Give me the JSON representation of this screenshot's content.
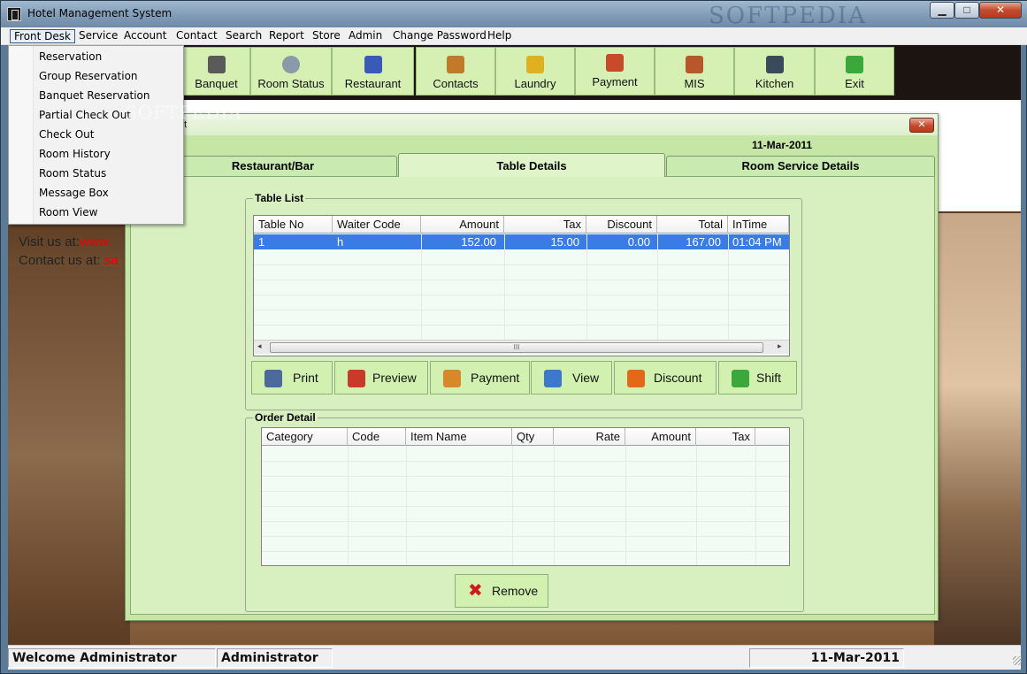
{
  "window": {
    "title": "Hotel Management System",
    "watermark": "SOFTPEDIA",
    "min": "▁",
    "max": "□",
    "close": "✕"
  },
  "menu": [
    "Front Desk",
    "Service",
    "Account",
    "Contact",
    "Search",
    "Report",
    "Store",
    "Admin",
    "Change Password",
    "Help"
  ],
  "dropdown": [
    "Reservation",
    "Group Reservation",
    "Banquet Reservation",
    "Partial Check Out",
    "Check Out",
    "Room History",
    "Room Status",
    "Message Box",
    "Room View"
  ],
  "toolbar": [
    {
      "label": "Banquet",
      "icon": "banquet-icon",
      "color": "#5a5a5a"
    },
    {
      "label": "Room Status",
      "icon": "room-status-icon",
      "color": "#8a9aa8"
    },
    {
      "label": "Restaurant",
      "icon": "restaurant-icon",
      "color": "#3a5ab8"
    },
    {
      "label": "Contacts",
      "icon": "contacts-icon",
      "color": "#c07a2a"
    },
    {
      "label": "Laundry",
      "icon": "laundry-icon",
      "color": "#e0b020"
    },
    {
      "label": "Payment",
      "icon": "payment-icon",
      "color": "#c84a2a"
    },
    {
      "label": "MIS",
      "icon": "mis-icon",
      "color": "#b8582a"
    },
    {
      "label": "Kitchen",
      "icon": "kitchen-icon",
      "color": "#3a4a5a"
    },
    {
      "label": "Exit",
      "icon": "exit-icon",
      "color": "#3aa83a"
    }
  ],
  "background": {
    "visit_label": "Visit us at:",
    "visit_url": "www.",
    "contact_label": "Contact us at: ",
    "contact_mail": "sa"
  },
  "dialog": {
    "title": "nt",
    "close": "✕",
    "date": "11-Mar-2011",
    "tabs": [
      "Restaurant/Bar",
      "Table Details",
      "Room Service Details"
    ],
    "table_list": {
      "title": "Table List",
      "columns": [
        "Table No",
        "Waiter Code",
        "Amount",
        "Tax",
        "Discount",
        "Total",
        "InTime"
      ],
      "rows": [
        [
          "1",
          "h",
          "152.00",
          "15.00",
          "0.00",
          "167.00",
          "01:04 PM"
        ]
      ],
      "scroll_thumb": "III"
    },
    "actions": [
      {
        "label": "Print",
        "icon": "print-icon",
        "color": "#4a6a9a"
      },
      {
        "label": "Preview",
        "icon": "preview-icon",
        "color": "#c83a2a"
      },
      {
        "label": "Payment",
        "icon": "payment-icon",
        "color": "#d8882a"
      },
      {
        "label": "View",
        "icon": "view-icon",
        "color": "#3a7ac8"
      },
      {
        "label": "Discount",
        "icon": "discount-icon",
        "color": "#e06a1a"
      },
      {
        "label": "Shift",
        "icon": "shift-arrow-icon",
        "color": "#3aa83a"
      }
    ],
    "order_detail": {
      "title": "Order Detail",
      "columns": [
        "Category",
        "Code",
        "Item Name",
        "Qty",
        "Rate",
        "Amount",
        "Tax"
      ]
    },
    "remove_label": "Remove"
  },
  "status": {
    "welcome": "Welcome Administrator",
    "user": "Administrator",
    "date": "11-Mar-2011"
  }
}
